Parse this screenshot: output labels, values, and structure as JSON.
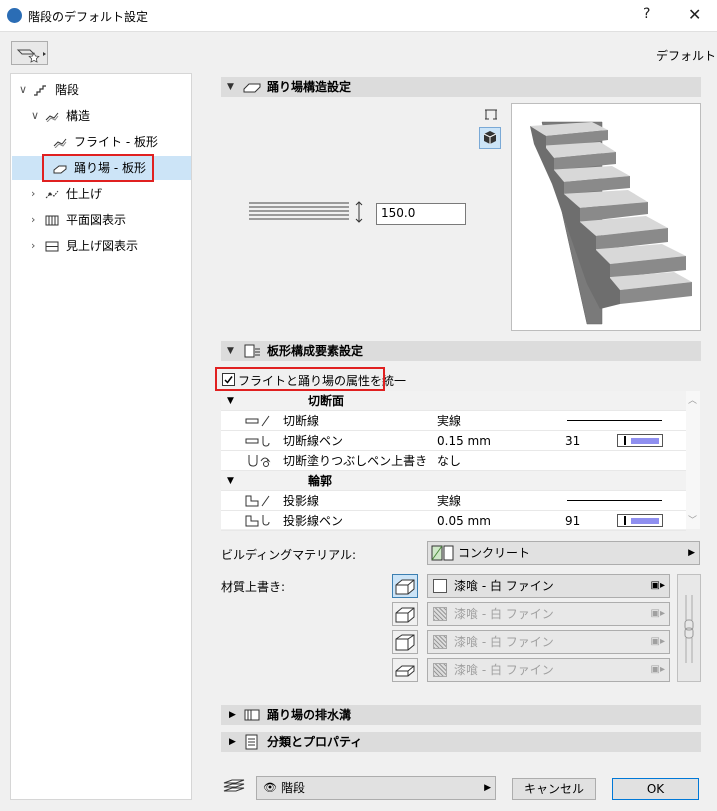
{
  "window": {
    "title": "階段のデフォルト設定",
    "help": "?",
    "close": "✕"
  },
  "header": {
    "default_label": "デフォルト"
  },
  "tree": {
    "items": [
      {
        "label": "階段",
        "icon": "stair-icon"
      },
      {
        "label": "構造",
        "icon": "structure-icon"
      },
      {
        "label": "フライト - 板形",
        "icon": "flight-icon"
      },
      {
        "label": "踊り場 - 板形",
        "icon": "landing-icon"
      },
      {
        "label": "仕上げ",
        "icon": "finish-icon"
      },
      {
        "label": "平面図表示",
        "icon": "floorplan-icon"
      },
      {
        "label": "見上げ図表示",
        "icon": "ceiling-plan-icon"
      }
    ]
  },
  "landing_structure": {
    "title": "踊り場構造設定",
    "thickness": "150.0"
  },
  "slab_components": {
    "title": "板形構成要素設定",
    "unify_label": "フライトと踊り場の属性を統一",
    "groups": [
      {
        "title": "切断面",
        "rows": [
          {
            "label": "切断線",
            "value": "実線",
            "num": ""
          },
          {
            "label": "切断線ペン",
            "value": "0.15 mm",
            "num": "31"
          },
          {
            "label": "切断塗りつぶしペン上書き",
            "value": "なし",
            "num": ""
          }
        ]
      },
      {
        "title": "輪郭",
        "rows": [
          {
            "label": "投影線",
            "value": "実線",
            "num": ""
          },
          {
            "label": "投影線ペン",
            "value": "0.05 mm",
            "num": "91"
          }
        ]
      }
    ],
    "building_material_label": "ビルディングマテリアル:",
    "building_material_value": "コンクリート",
    "surface_override_label": "材質上書き:",
    "surfaces": [
      "漆喰 - 白 ファイン",
      "漆喰 - 白 ファイン",
      "漆喰 - 白 ファイン",
      "漆喰 - 白 ファイン"
    ]
  },
  "sections": {
    "drainage": "踊り場の排水溝",
    "classification": "分類とプロパティ"
  },
  "footer": {
    "layer": "階段",
    "cancel": "キャンセル",
    "ok": "OK"
  }
}
